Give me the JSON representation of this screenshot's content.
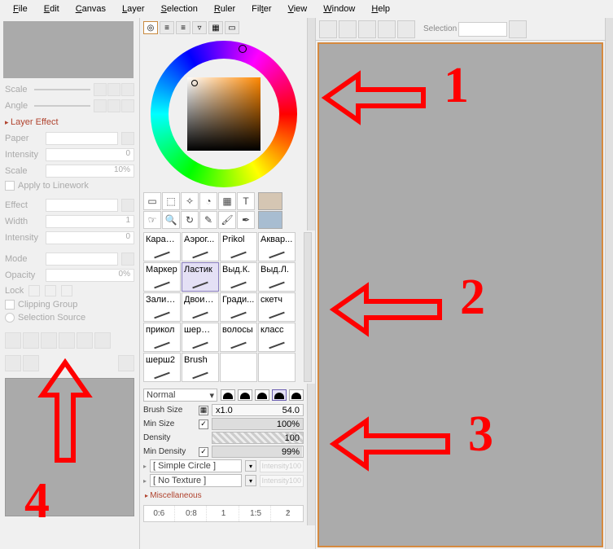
{
  "menu": [
    "File",
    "Edit",
    "Canvas",
    "Layer",
    "Selection",
    "Ruler",
    "Filter",
    "View",
    "Window",
    "Help"
  ],
  "left": {
    "scale_label": "Scale",
    "angle_label": "Angle",
    "section_layer_effect": "Layer Effect",
    "paper_label": "Paper",
    "intensity_label": "Intensity",
    "intensity_val": "0",
    "scale2_label": "Scale",
    "scale2_val": "10%",
    "apply_linework": "Apply to Linework",
    "effect_label": "Effect",
    "width_label": "Width",
    "width_val": "1",
    "intensity2_label": "Intensity",
    "intensity2_val": "0",
    "mode_label": "Mode",
    "opacity_label": "Opacity",
    "opacity_val": "0%",
    "lock_label": "Lock",
    "clipping_group": "Clipping Group",
    "selection_source": "Selection Source"
  },
  "mid": {
    "tools_row1": [
      "▭",
      "⬚",
      "✧",
      "◔",
      "▦",
      "T"
    ],
    "tools_row2": [
      "☞",
      "🔍",
      "↻",
      "✎",
      "🖌",
      "✒"
    ],
    "brushes": [
      [
        "Каранд.",
        "Аэрог...",
        "Prikol",
        "Аквар..."
      ],
      [
        "Маркер",
        "Ластик",
        "Выд.К.",
        "Выд.Л."
      ],
      [
        "Заливка",
        "Двоич...",
        "Гради...",
        "скетч"
      ],
      [
        "прикол",
        "шерша...",
        "волосы",
        "класс"
      ],
      [
        "шерш2",
        "Brush",
        "",
        ""
      ]
    ],
    "selected_brush": "Ластик",
    "blend_mode": "Normal",
    "brush_size_label": "Brush Size",
    "brush_size_mult": "x1.0",
    "brush_size_val": "54.0",
    "min_size_label": "Min Size",
    "min_size_val": "100%",
    "density_label": "Density",
    "density_val": "100",
    "min_density_label": "Min Density",
    "min_density_val": "99%",
    "shape_label": "[ Simple Circle ]",
    "shape_intensity": "Intensity100",
    "texture_label": "[ No Texture ]",
    "texture_intensity": "Intensity100",
    "misc_label": "Miscellaneous",
    "spacing": [
      "0.6",
      "0.8",
      "1",
      "1.5",
      "2"
    ]
  },
  "right": {
    "selection_label": "Selection"
  },
  "annotations": {
    "n1": "1",
    "n2": "2",
    "n3": "3",
    "n4": "4"
  }
}
